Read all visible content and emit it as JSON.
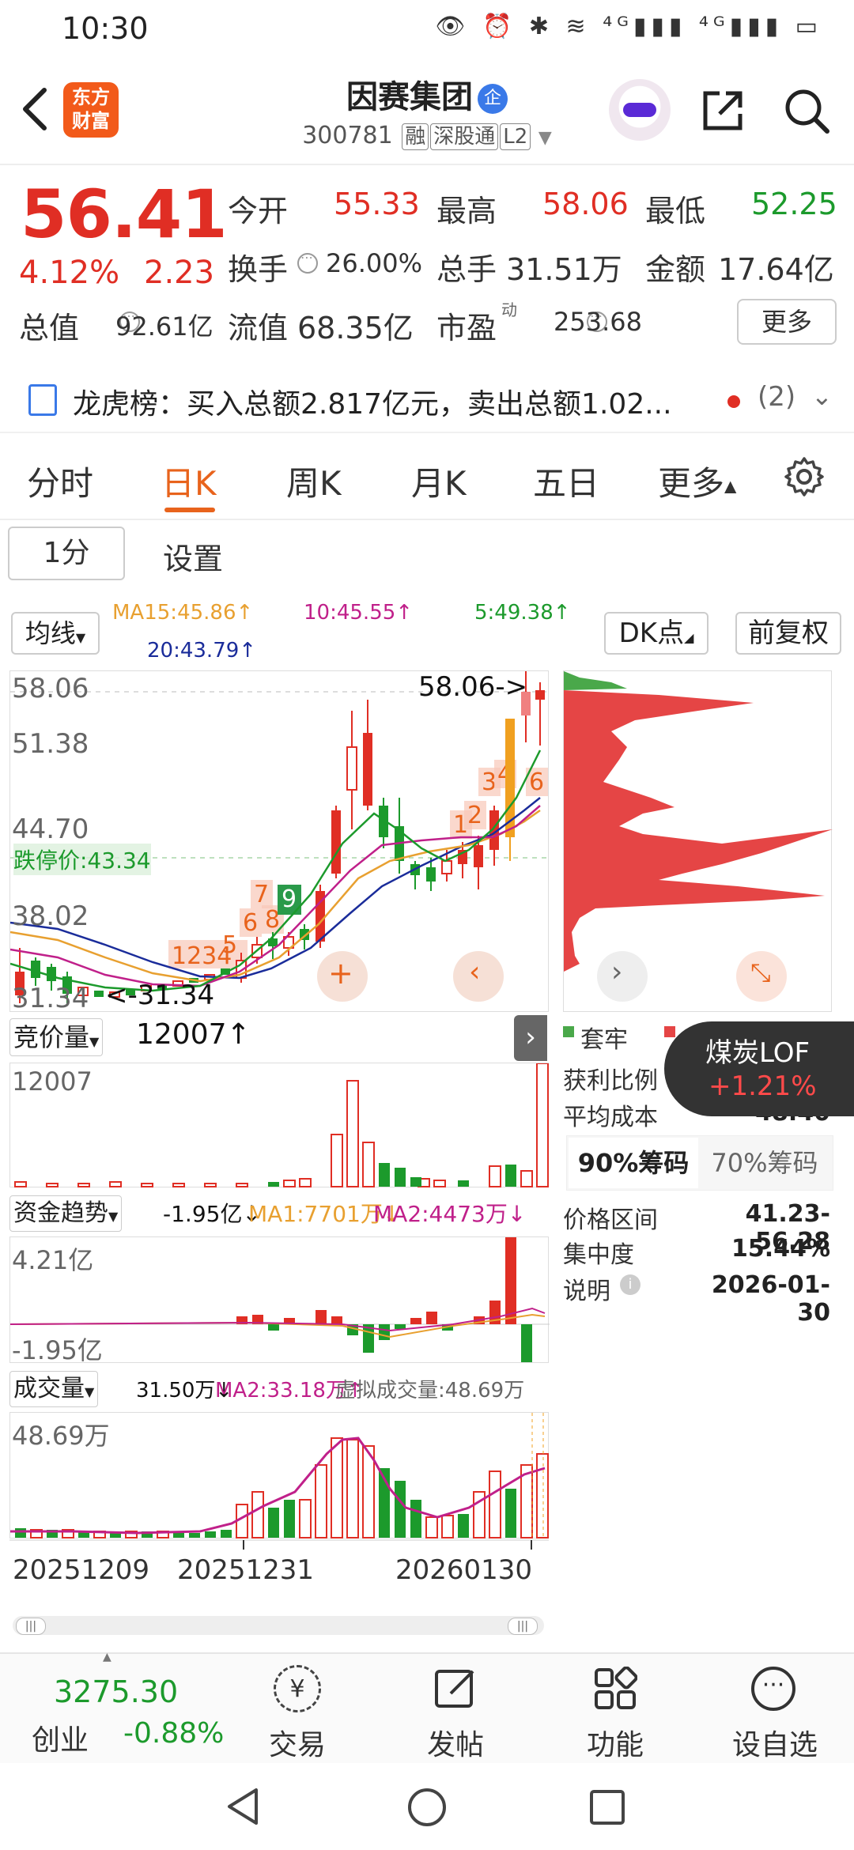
{
  "status_bar": {
    "time": "10:30",
    "icons": "👁 ⏰ ✱ ≋ ⁴ᴳ▮▮▮ ⁴ᴳ▮▮▮ ▭"
  },
  "header": {
    "logo_text_line1": "东方",
    "logo_text_line2": "财富",
    "stock_name": "因赛集团",
    "name_badge": "企",
    "stock_code": "300781",
    "tags": [
      "融",
      "深股通",
      "L2"
    ]
  },
  "quote": {
    "price": "56.41",
    "change_pct": "4.12%",
    "change_amt": "2.23",
    "open_label": "今开",
    "open": "55.33",
    "high_label": "最高",
    "high": "58.06",
    "low_label": "最低",
    "low": "52.25",
    "turnover_label": "换手",
    "turnover": "26.00%",
    "volume_label": "总手",
    "volume": "31.51万",
    "amount_label": "金额",
    "amount": "17.64亿",
    "mktcap_label": "总值",
    "mktcap": "92.61亿",
    "float_label": "流值",
    "float": "68.35亿",
    "pe_label": "市盈",
    "pe_sup": "动",
    "pe": "253.68",
    "more_label": "更多"
  },
  "dragon_tiger": {
    "text": "龙虎榜：买入总额2.817亿元，卖出总额1.02...",
    "count": "(2)"
  },
  "tabs": [
    "分时",
    "日K",
    "周K",
    "月K",
    "五日",
    "更多"
  ],
  "active_tab_index": 1,
  "controls": {
    "interval": "1分",
    "settings": "设置",
    "ma_dropdown": "均线",
    "ma15": "MA15:45.86↑",
    "ma10": "10:45.55↑",
    "ma5": "5:49.38↑",
    "ma20": "20:43.79↑",
    "dk_label": "DK点",
    "adjust_label": "前复权"
  },
  "kline": {
    "y_labels": [
      "58.06",
      "51.38",
      "44.70",
      "38.02",
      "31.34"
    ],
    "high_mark": "58.06->",
    "low_mark": "<-31.34",
    "limit_down_label": "跌停价:43.34",
    "seq_labels": [
      "1",
      "2",
      "3",
      "4",
      "5",
      "6",
      "7",
      "8",
      "9",
      "1",
      "2",
      "3",
      "4",
      "6"
    ]
  },
  "chips": {
    "legend_trapped": "套牢",
    "profit_label": "获利比例",
    "avg_cost_label": "平均成本",
    "avg_cost": "48.40",
    "tab_90": "90%筹码",
    "tab_70": "70%筹码",
    "range_label": "价格区间",
    "range": "41.23-56.28",
    "conc_label": "集中度",
    "conc": "15.44%",
    "note_label": "说明",
    "note_date": "2026-01-30"
  },
  "floating_chip": {
    "name": "煤炭LOF",
    "change": "+1.21%"
  },
  "auction_panel": {
    "dropdown": "竞价量",
    "value": "12007↑",
    "max_label": "12007"
  },
  "fund_panel": {
    "dropdown": "资金趋势",
    "value": "-1.95亿↓",
    "ma1": "MA1:7701万↓",
    "ma2": "MA2:4473万↓",
    "max_label": "4.21亿",
    "min_label": "-1.95亿"
  },
  "volume_panel": {
    "dropdown": "成交量",
    "value": "31.50万↓",
    "ma2": "MA2:33.18万↑",
    "virtual": "虚拟成交量:48.69万",
    "max_label": "48.69万",
    "dates": [
      "20251209",
      "20251231",
      "20260130"
    ]
  },
  "bottom_nav": {
    "index_value": "3275.30",
    "index_name": "创业",
    "index_change": "-0.88%",
    "items": [
      "交易",
      "发帖",
      "功能",
      "设自选"
    ]
  },
  "colors": {
    "up": "#e02e24",
    "down": "#1c9a2c",
    "accent": "#e8631c",
    "ma15": "#e8a030",
    "ma10": "#c0208a",
    "ma5": "#1c9a2c",
    "ma20": "#1a2c9a"
  }
}
